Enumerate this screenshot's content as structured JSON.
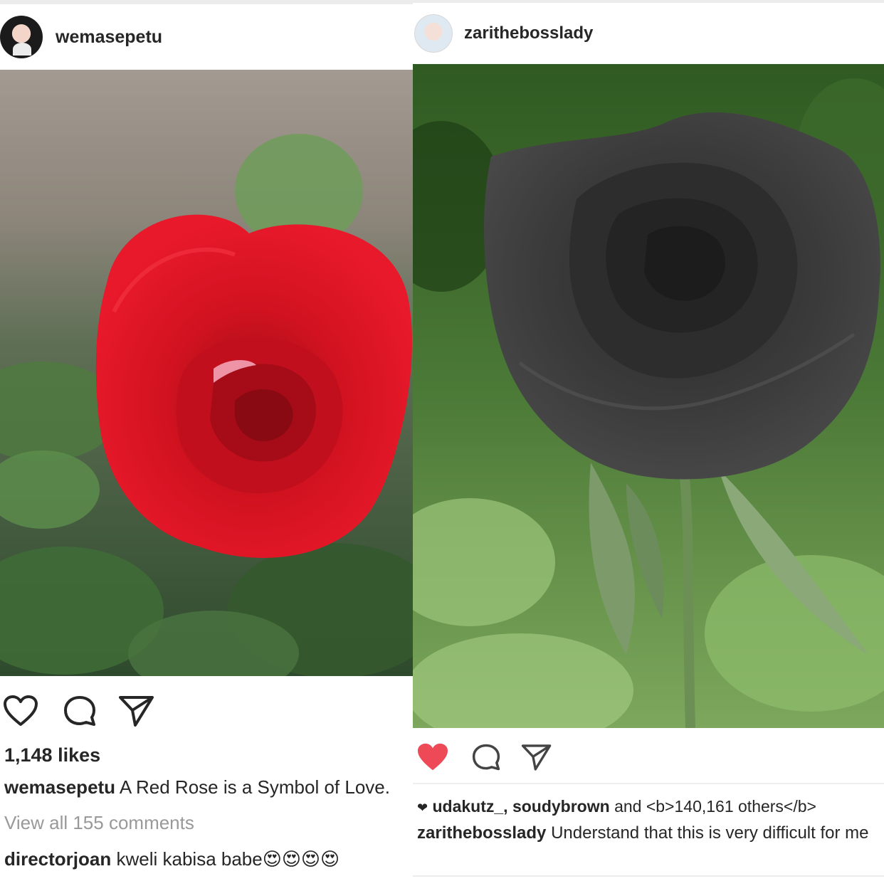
{
  "left_post": {
    "username": "wemasepetu",
    "likes": "1,148 likes",
    "caption_user": "wemasepetu",
    "caption_text": "A Red Rose is a Symbol of Love.",
    "view_all": "View all 155 comments",
    "comment_user": "directorjoan",
    "comment_text": "kweli kabisa babe😍😍😍😍",
    "icons": [
      "heart-outline-icon",
      "comment-icon",
      "share-icon"
    ]
  },
  "right_post": {
    "username": "zarithebosslady",
    "liked_by_users": "udakutz_, soudybrown",
    "liked_by_and": "and",
    "liked_by_count": "<b>140,161 others</b>",
    "caption_user": "zarithebosslady",
    "caption_text": "Understand that this is very difficult for me",
    "icons": [
      "heart-filled-icon",
      "comment-icon",
      "share-icon"
    ]
  },
  "colors": {
    "like_red": "#ed4956",
    "text": "#262626",
    "muted": "#999999",
    "divider": "#efefef"
  }
}
